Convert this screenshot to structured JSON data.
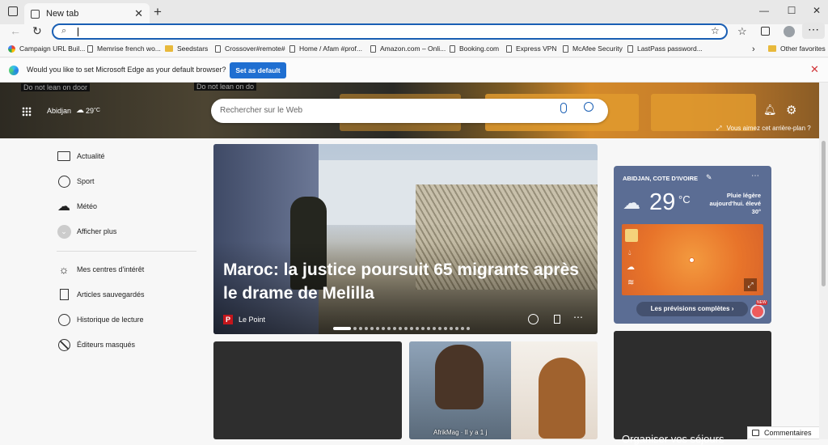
{
  "tab": {
    "title": "New tab"
  },
  "bookmarks": [
    {
      "label": "Campaign URL Buil...",
      "type": "site"
    },
    {
      "label": "Memrise french wo...",
      "type": "page"
    },
    {
      "label": "Seedstars",
      "type": "folder"
    },
    {
      "label": "Crossover#remote#",
      "type": "page"
    },
    {
      "label": "Home / Afam #prof...",
      "type": "page"
    },
    {
      "label": "Amazon.com – Onli...",
      "type": "page"
    },
    {
      "label": "Booking.com",
      "type": "page"
    },
    {
      "label": "Express VPN",
      "type": "page"
    },
    {
      "label": "McAfee Security",
      "type": "page"
    },
    {
      "label": "LastPass password...",
      "type": "page"
    }
  ],
  "other_favorites": "Other favorites",
  "infobar": {
    "message": "Would you like to set Microsoft Edge as your default browser?",
    "button": "Set as default"
  },
  "hero": {
    "location": "Abidjan",
    "temp": "29",
    "temp_unit": "°C",
    "search_placeholder": "Rechercher sur le Web",
    "background_prompt": "Vous aimez cet arrière-plan ?",
    "sign_left": "Do not lean on door",
    "sign_right": "Do not lean on do"
  },
  "sidebar": {
    "top": [
      "Actualité",
      "Sport",
      "Météo",
      "Afficher plus"
    ],
    "bottom": [
      "Mes centres d'intérêt",
      "Articles sauvegardés",
      "Historique de lecture",
      "Éditeurs masqués"
    ]
  },
  "main_article": {
    "headline_line1": "Maroc: la justice poursuit 65 migrants après",
    "headline_line2": "le drame de Melilla",
    "source": "Le Point",
    "source_letter": "P"
  },
  "card3": {
    "source": "AfrikMag · Il y a 1 j"
  },
  "weather": {
    "location": "ABIDJAN, COTE D'IVOIRE",
    "temp": "29",
    "unit": "°C",
    "desc_line1": "Pluie légère",
    "desc_line2": "aujourd'hui. élevé",
    "desc_line3": "30°",
    "forecast_button": "Les prévisions complètes",
    "new_badge": "NEW"
  },
  "card4": {
    "title": "Organiser vos séjours"
  },
  "feedback": "Commentaires",
  "colors": {
    "accent": "#1f6fd1",
    "weather_bg": "#5b6d94",
    "heat_orange": "#e8742a"
  }
}
